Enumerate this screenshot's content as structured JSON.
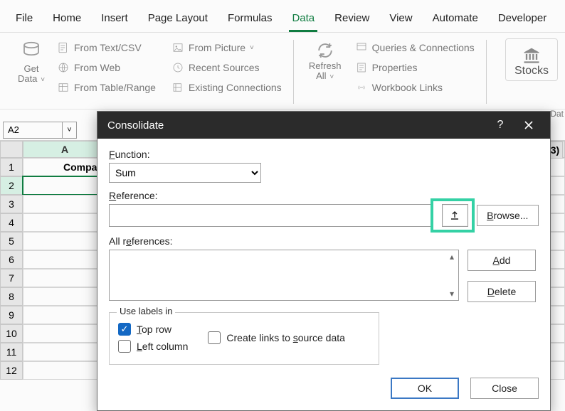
{
  "menu": {
    "items": [
      "File",
      "Home",
      "Insert",
      "Page Layout",
      "Formulas",
      "Data",
      "Review",
      "View",
      "Automate",
      "Developer"
    ],
    "active": "Data"
  },
  "ribbon": {
    "get_data": {
      "label1": "Get",
      "label2": "Data"
    },
    "source_list": [
      "From Text/CSV",
      "From Web",
      "From Table/Range"
    ],
    "picture_list": [
      "From Picture",
      "Recent Sources",
      "Existing Connections"
    ],
    "refresh": {
      "label1": "Refresh",
      "label2": "All"
    },
    "queries_list": [
      "Queries & Connections",
      "Properties",
      "Workbook Links"
    ],
    "stocks": "Stocks",
    "group_label": "Dat"
  },
  "namebox": "A2",
  "colheaders": {
    "A": "A",
    "frag": "3)"
  },
  "rows": [
    "1",
    "2",
    "3",
    "4",
    "5",
    "6",
    "7",
    "8",
    "9",
    "10",
    "11",
    "12"
  ],
  "cellA1": "Compan",
  "dialog": {
    "title": "Consolidate",
    "function_label": "Function:",
    "function_value": "Sum",
    "reference_label": "Reference:",
    "browse": "Browse...",
    "allrefs_label": "All references:",
    "add": "Add",
    "delete": "Delete",
    "use_labels": "Use labels in",
    "top_row": "Top row",
    "left_column": "Left column",
    "create_links": "Create links to source data",
    "ok": "OK",
    "close": "Close"
  }
}
